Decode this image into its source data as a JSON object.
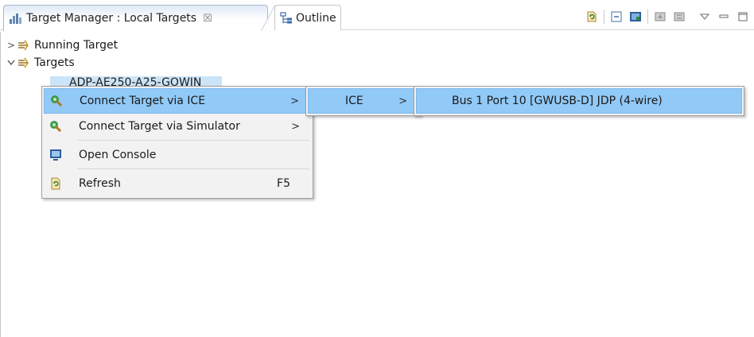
{
  "tabs": [
    {
      "label": "Target Manager : Local Targets",
      "close_glyph": "☒",
      "icon": "target-manager-icon",
      "active": true
    },
    {
      "label": "Outline",
      "icon": "outline-icon",
      "active": false
    }
  ],
  "toolbar": {
    "buttons": [
      "refresh-icon",
      "collapse-all-icon",
      "show-console-icon",
      "connect-icon",
      "disconnect-icon",
      "view-menu-icon",
      "minimize-icon",
      "maximize-icon"
    ]
  },
  "tree": {
    "items": [
      {
        "label": "Running Target",
        "expanded": false,
        "twisty": ">"
      },
      {
        "label": "Targets",
        "expanded": true,
        "twisty": "v"
      },
      {
        "label": "ADP-AE250-A25-GOWIN",
        "selected": true
      }
    ]
  },
  "context_menu": {
    "items": [
      {
        "label": "Connect Target via ICE",
        "icon": "connect-ice-icon",
        "submenu_arrow": ">",
        "highlighted": true
      },
      {
        "label": "Connect Target via Simulator",
        "icon": "connect-simulator-icon",
        "submenu_arrow": ">"
      },
      {
        "label": "Open Console",
        "icon": "console-icon"
      },
      {
        "label": "Refresh",
        "icon": "refresh-icon",
        "accelerator": "F5"
      }
    ]
  },
  "submenu_ice": {
    "items": [
      {
        "label": "ICE",
        "submenu_arrow": ">",
        "highlighted": true
      }
    ]
  },
  "submenu_port": {
    "items": [
      {
        "label": "Bus 1 Port 10 [GWUSB-D] JDP (4-wire)",
        "highlighted": true
      }
    ]
  },
  "colors": {
    "highlight": "#91c9f7",
    "selection": "#cce4f7",
    "menu_bg": "#f2f2f2"
  }
}
